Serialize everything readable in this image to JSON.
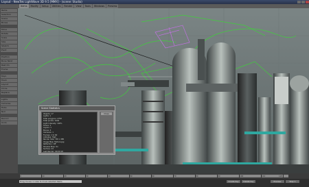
{
  "window": {
    "title": "Layout - NewTek LightWave 3D 9.5 [MMX] - (scene: Studio)"
  },
  "tabs": [
    "Items",
    "Modify",
    "Setup",
    "Utilities",
    "Render",
    "View",
    "Tools",
    "Windows",
    "Preview"
  ],
  "sidebar": {
    "items": [
      "Items",
      "Selection",
      "Scene",
      "Bones",
      "Move",
      "Rotate",
      "Scale",
      "Size",
      "Stretch",
      "Pivot",
      "Position",
      "Bone Twist",
      "Rest On",
      "Frame",
      "Keys",
      "Track",
      "Layout",
      "Clone",
      "Replace",
      "Lights",
      "Cameras",
      "Hubs",
      "Null",
      "Record",
      "Undo"
    ]
  },
  "panel": {
    "title": "Scene Statistics",
    "button": "Close",
    "lines": [
      "Objects: 17",
      "Lights: 1",
      "Total polygons: 2793",
      "Total points: 1604",
      "Light Intensity: 100%",
      "Scene: 1",
      "Layers: 1",
      "Bones: 4",
      "Cameras: 1",
      "Frames: 1 to 60",
      "Antialias: High",
      "Render Size: 720 x 480",
      "Image Map: Texture.jpg",
      "Reflection: Off",
      "Shadow Map: On",
      "Surface: 23",
      "Last Render: 00:00:18"
    ]
  },
  "timeline": {
    "ticks": [
      "0",
      "10",
      "20",
      "30",
      "40",
      "50",
      "60",
      "70",
      "80",
      "90",
      "100",
      "110",
      "120"
    ]
  },
  "status": {
    "message": "Drag mouse in view to move selected items",
    "buttons": [
      "Create Key",
      "Delete Key",
      "Preview",
      "Step 1"
    ]
  },
  "colors": {
    "wire_green": "#3fd03a",
    "wire_magenta": "#c070e0",
    "bg_grid": "#6f7a7a"
  }
}
